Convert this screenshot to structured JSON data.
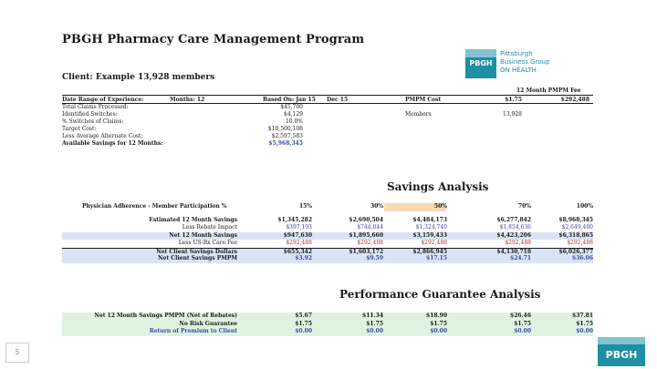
{
  "title": "PBGH Pharmacy Care Management Program",
  "logo": {
    "badge": "PBGH",
    "line1": "Pittsburgh",
    "line2": "Business Group",
    "line3": "ON HEALTH"
  },
  "client": "Client: Example 13,928 members",
  "pmpm_header": "12 Month PMPM Fee",
  "experience": {
    "head": {
      "label": "Date Range of Experience:",
      "months": "Months: 12",
      "based": "Based On: Jan 15",
      "through": "Dec 15",
      "pmpm_cost_label": "PMPM Cost",
      "pmpm_cost": "$1.75",
      "annual_fee": "$292,488"
    },
    "rows": [
      {
        "label": "Total Claims Processed:",
        "value": "$45,700",
        "extra_label": "",
        "extra_value": ""
      },
      {
        "label": "Identified Switches:",
        "value": "$4,129",
        "extra_label": "Members",
        "extra_value": "13,928"
      },
      {
        "label": "% Switches of Claims:",
        "value": "10.0%",
        "extra_label": "",
        "extra_value": ""
      },
      {
        "label": "Target Cost:",
        "value": "$10,500,108",
        "extra_label": "",
        "extra_value": ""
      },
      {
        "label": "Less Average Alternate Cost:",
        "value": "$2,597,583",
        "extra_label": "",
        "extra_value": ""
      },
      {
        "label": "Available Savings for 12 Months:",
        "value": "$5,968,345",
        "extra_label": "",
        "extra_value": ""
      }
    ]
  },
  "savings": {
    "title": "Savings Analysis",
    "header": {
      "label": "Physician Adherence - Member Participation %",
      "cols": [
        "15%",
        "30%",
        "50%",
        "70%",
        "100%"
      ]
    },
    "rows": [
      {
        "label": "Estimated 12 Month Savings",
        "values": [
          "$1,345,282",
          "$2,690,504",
          "$4,484,173",
          "$6,277,842",
          "$8,968,345"
        ]
      },
      {
        "label": "Less Rebate Impact",
        "values": [
          "$397,193",
          "$744,844",
          "$1,324,740",
          "$1,854,636",
          "$2,649,480"
        ]
      },
      {
        "label": "Net 12 Month Savings",
        "values": [
          "$947,630",
          "$1,895,660",
          "$3,159,433",
          "$4,423,206",
          "$6,318,865"
        ]
      },
      {
        "label": "Less US-Rx Care Fee",
        "values": [
          "$292,488",
          "$292,488",
          "$292,488",
          "$292,488",
          "$292,488"
        ]
      },
      {
        "label": "Net Client Savings Dollars",
        "values": [
          "$655,342",
          "$1,603,172",
          "$2,866,945",
          "$4,130,718",
          "$6,026,377"
        ]
      },
      {
        "label": "Net Client Savings PMPM",
        "values": [
          "$3.92",
          "$9.59",
          "$17.15",
          "$24.71",
          "$36.06"
        ]
      }
    ]
  },
  "performance": {
    "title": "Performance Guarantee Analysis",
    "rows": [
      {
        "label": "Net 12 Month Savings PMPM (Net of Rebates)",
        "values": [
          "$5.67",
          "$11.34",
          "$18.90",
          "$26.46",
          "$37.81"
        ]
      },
      {
        "label": "No Risk Guarantee",
        "values": [
          "$1.75",
          "$1.75",
          "$1.75",
          "$1.75",
          "$1.75"
        ]
      },
      {
        "label": "Return of Premium to Client",
        "values": [
          "$0.00",
          "$0.00",
          "$0.00",
          "$0.00",
          "$0.00"
        ]
      }
    ]
  },
  "page_number": "5",
  "footer_logo": "PBGH"
}
